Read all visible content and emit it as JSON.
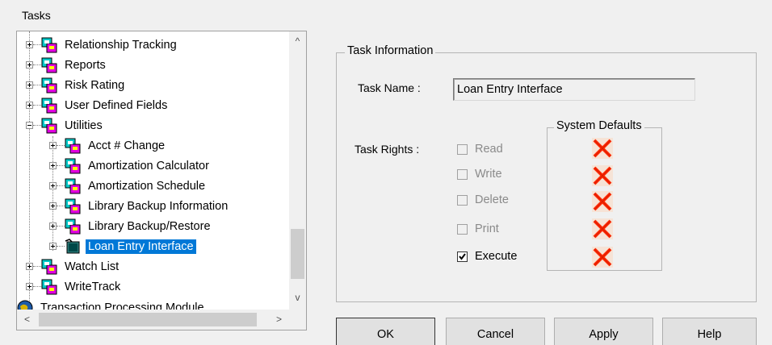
{
  "tasks_label": "Tasks",
  "tree": {
    "items": [
      {
        "label": "Relationship Tracking"
      },
      {
        "label": "Reports"
      },
      {
        "label": "Risk Rating"
      },
      {
        "label": "User Defined Fields"
      },
      {
        "label": "Utilities"
      },
      {
        "label": "Acct # Change"
      },
      {
        "label": "Amortization Calculator"
      },
      {
        "label": "Amortization Schedule"
      },
      {
        "label": "Library Backup Information"
      },
      {
        "label": "Library Backup/Restore"
      },
      {
        "label": "Loan Entry Interface"
      },
      {
        "label": "Watch List"
      },
      {
        "label": "WriteTrack"
      },
      {
        "label": "Transaction Processing Module"
      }
    ],
    "selected": "Loan Entry Interface"
  },
  "scroll": {
    "up": "^",
    "down": "v",
    "left": "<",
    "right": ">"
  },
  "task_info": {
    "title": "Task Information",
    "task_name_label": "Task Name :",
    "task_name_value": "Loan Entry Interface",
    "task_rights_label": "Task Rights :",
    "system_defaults_title": "System Defaults",
    "rights": [
      {
        "label": "Read",
        "checked": false,
        "enabled": false
      },
      {
        "label": "Write",
        "checked": false,
        "enabled": false
      },
      {
        "label": "Delete",
        "checked": false,
        "enabled": false
      },
      {
        "label": "Print",
        "checked": false,
        "enabled": false
      },
      {
        "label": "Execute",
        "checked": true,
        "enabled": true
      }
    ]
  },
  "buttons": {
    "ok": "OK",
    "cancel": "Cancel",
    "apply": "Apply",
    "help": "Help"
  },
  "colors": {
    "selection": "#0078d7",
    "task_icon_cyan": "#00c8c8",
    "task_icon_magenta": "#e000e0",
    "x_red": "#ff2a00"
  }
}
